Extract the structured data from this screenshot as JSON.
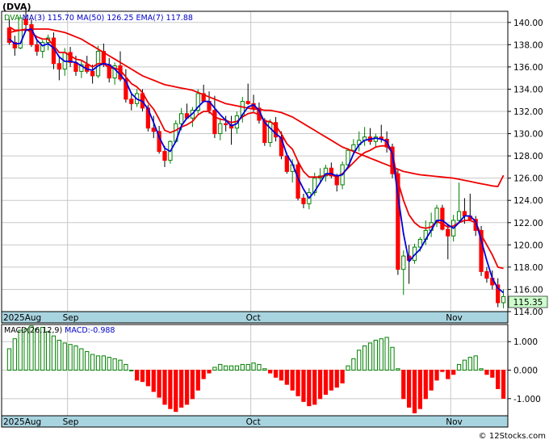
{
  "ticker_label": "(DVA)",
  "price_legend": [
    {
      "text": "DVA",
      "color": "#008000"
    },
    {
      "text": "MA(3)",
      "color": "#0000cc"
    },
    {
      "text": "115.70",
      "color": "#0000cc"
    },
    {
      "text": "MA(50)",
      "color": "#0000cc"
    },
    {
      "text": "126.25",
      "color": "#0000cc"
    },
    {
      "text": "EMA(7)",
      "color": "#0000cc"
    },
    {
      "text": "117.88",
      "color": "#0000cc"
    }
  ],
  "macd_legend": [
    {
      "text": "MACD(26,12,9)",
      "color": "#000000"
    },
    {
      "text": "MACD:-0.988",
      "color": "#0000cc"
    }
  ],
  "last_price_label": "115.35",
  "month_labels": [
    "2025Aug",
    "Sep",
    "Oct",
    "Nov"
  ],
  "copyright": "© 12Stocks.com",
  "colors": {
    "up_candle": "#008000",
    "down_candle": "#ff0000",
    "ma3": "#0000dd",
    "ema7": "#ee0000",
    "ma50": "#ee0000",
    "macd_bar_pos": "#008000",
    "macd_bar_neg": "#ff0000",
    "month_band": "#a8d4e0",
    "price_box": "#ccffcc",
    "grid": "#c8c8c8"
  },
  "chart_data": [
    {
      "type": "candlestick",
      "title": "(DVA)",
      "ylim": [
        114,
        141
      ],
      "y_ticks": [
        "114.00",
        "116.00",
        "118.00",
        "120.00",
        "122.00",
        "124.00",
        "126.00",
        "128.00",
        "130.00",
        "132.00",
        "134.00",
        "136.00",
        "138.00",
        "140.00"
      ],
      "y_tick_values": [
        114,
        116,
        118,
        120,
        122,
        124,
        126,
        128,
        130,
        132,
        134,
        136,
        138,
        140
      ],
      "x_month_labels": [
        {
          "label": "2025Aug",
          "index": 0
        },
        {
          "label": "Sep",
          "index": 11
        },
        {
          "label": "Oct",
          "index": 44
        },
        {
          "label": "Nov",
          "index": 80
        }
      ],
      "last_price": 115.35,
      "candles": [
        [
          139.5,
          140.3,
          138.0,
          138.2
        ],
        [
          138.2,
          138.8,
          137.0,
          137.7
        ],
        [
          137.7,
          140.7,
          137.6,
          140.4
        ],
        [
          140.3,
          141.3,
          139.3,
          139.8
        ],
        [
          139.8,
          140.3,
          137.8,
          138.0
        ],
        [
          138.0,
          138.4,
          137.0,
          137.4
        ],
        [
          137.4,
          138.4,
          136.8,
          138.2
        ],
        [
          138.2,
          138.9,
          137.5,
          138.6
        ],
        [
          138.6,
          139.1,
          135.8,
          136.3
        ],
        [
          136.3,
          137.0,
          134.8,
          135.8
        ],
        [
          135.8,
          137.7,
          135.2,
          137.3
        ],
        [
          137.3,
          137.8,
          136.0,
          136.4
        ],
        [
          136.4,
          137.0,
          135.2,
          135.6
        ],
        [
          135.6,
          136.6,
          135.0,
          136.2
        ],
        [
          136.2,
          137.0,
          135.4,
          135.6
        ],
        [
          135.6,
          136.2,
          134.5,
          135.2
        ],
        [
          135.2,
          137.9,
          135.0,
          137.4
        ],
        [
          137.4,
          138.1,
          136.0,
          136.2
        ],
        [
          136.2,
          136.8,
          134.6,
          135.0
        ],
        [
          135.0,
          136.4,
          134.4,
          136.1
        ],
        [
          136.1,
          137.4,
          134.7,
          134.9
        ],
        [
          134.9,
          135.8,
          132.8,
          133.1
        ],
        [
          133.1,
          133.6,
          132.1,
          132.7
        ],
        [
          132.7,
          134.0,
          132.4,
          133.6
        ],
        [
          133.6,
          134.0,
          132.0,
          132.3
        ],
        [
          132.3,
          132.6,
          130.2,
          130.5
        ],
        [
          130.5,
          131.6,
          129.6,
          130.2
        ],
        [
          130.2,
          130.7,
          128.2,
          128.4
        ],
        [
          128.4,
          128.9,
          127.0,
          127.6
        ],
        [
          127.6,
          129.4,
          127.3,
          129.3
        ],
        [
          129.3,
          131.2,
          129.2,
          130.9
        ],
        [
          130.9,
          132.3,
          130.3,
          131.8
        ],
        [
          131.8,
          132.7,
          131.3,
          131.4
        ],
        [
          131.4,
          132.4,
          130.6,
          132.1
        ],
        [
          132.1,
          134.0,
          131.8,
          133.6
        ],
        [
          133.6,
          134.4,
          132.8,
          132.9
        ],
        [
          132.9,
          133.8,
          131.8,
          132.1
        ],
        [
          132.1,
          133.4,
          129.6,
          130.0
        ],
        [
          130.0,
          131.4,
          129.4,
          130.9
        ],
        [
          130.9,
          131.6,
          130.2,
          130.8
        ],
        [
          130.8,
          131.6,
          129.0,
          130.5
        ],
        [
          130.5,
          132.0,
          130.0,
          131.6
        ],
        [
          131.6,
          133.3,
          131.0,
          132.9
        ],
        [
          132.9,
          134.5,
          132.6,
          132.7
        ],
        [
          132.7,
          133.5,
          132.0,
          132.3
        ],
        [
          132.3,
          132.8,
          130.9,
          131.2
        ],
        [
          131.2,
          131.4,
          128.9,
          129.2
        ],
        [
          129.2,
          131.3,
          128.8,
          131.0
        ],
        [
          131.0,
          131.5,
          129.3,
          129.7
        ],
        [
          129.7,
          130.2,
          127.7,
          128.0
        ],
        [
          128.0,
          128.3,
          126.4,
          126.6
        ],
        [
          126.6,
          127.7,
          125.6,
          127.2
        ],
        [
          127.2,
          127.5,
          124.0,
          124.2
        ],
        [
          124.2,
          124.6,
          123.3,
          123.7
        ],
        [
          123.7,
          125.1,
          123.2,
          124.7
        ],
        [
          124.7,
          126.5,
          124.4,
          126.0
        ],
        [
          126.0,
          126.9,
          125.5,
          126.2
        ],
        [
          126.2,
          127.2,
          125.7,
          126.9
        ],
        [
          126.9,
          127.4,
          126.0,
          126.2
        ],
        [
          126.2,
          126.4,
          124.8,
          125.4
        ],
        [
          125.4,
          127.5,
          125.0,
          127.2
        ],
        [
          127.2,
          128.7,
          127.0,
          128.5
        ],
        [
          128.5,
          129.5,
          128.1,
          129.0
        ],
        [
          129.0,
          130.2,
          128.4,
          129.4
        ],
        [
          129.4,
          130.6,
          128.9,
          129.7
        ],
        [
          129.7,
          130.5,
          129.0,
          129.3
        ],
        [
          129.3,
          130.0,
          128.8,
          129.7
        ],
        [
          129.7,
          130.8,
          129.2,
          129.5
        ],
        [
          129.5,
          130.2,
          128.3,
          128.8
        ],
        [
          128.8,
          129.1,
          126.0,
          126.4
        ],
        [
          126.4,
          126.8,
          117.3,
          117.8
        ],
        [
          117.8,
          119.5,
          115.5,
          119.0
        ],
        [
          119.0,
          120.0,
          116.5,
          118.6
        ],
        [
          118.6,
          120.1,
          118.3,
          119.8
        ],
        [
          119.8,
          120.7,
          119.4,
          120.5
        ],
        [
          120.5,
          122.2,
          120.0,
          121.3
        ],
        [
          121.3,
          122.9,
          120.7,
          122.0
        ],
        [
          122.0,
          123.6,
          121.6,
          123.3
        ],
        [
          123.3,
          123.6,
          121.3,
          121.4
        ],
        [
          121.4,
          121.9,
          118.7,
          120.8
        ],
        [
          120.8,
          122.7,
          120.3,
          122.2
        ],
        [
          122.2,
          125.6,
          121.9,
          123.0
        ],
        [
          123.0,
          124.2,
          121.9,
          122.6
        ],
        [
          122.6,
          124.6,
          122.2,
          122.3
        ],
        [
          122.3,
          122.6,
          120.8,
          121.3
        ],
        [
          121.3,
          121.7,
          117.2,
          117.6
        ],
        [
          117.6,
          118.0,
          116.6,
          117.0
        ],
        [
          117.0,
          117.7,
          116.0,
          116.4
        ],
        [
          116.4,
          117.0,
          114.4,
          114.8
        ],
        [
          114.8,
          116.0,
          114.3,
          115.35
        ]
      ],
      "ma3": [
        138.5,
        138.1,
        138.1,
        139.3,
        139.4,
        138.4,
        137.9,
        138.1,
        137.7,
        136.9,
        136.5,
        136.5,
        136.4,
        136.1,
        135.8,
        135.7,
        136.1,
        136.3,
        136.2,
        135.8,
        135.3,
        134.7,
        133.6,
        133.1,
        132.9,
        132.2,
        131.0,
        129.7,
        128.7,
        128.4,
        129.3,
        130.7,
        131.4,
        131.8,
        132.4,
        132.9,
        132.9,
        132.3,
        131.7,
        131.2,
        130.7,
        130.9,
        131.7,
        132.4,
        132.6,
        132.1,
        131.0,
        130.5,
        130.0,
        129.6,
        128.1,
        127.3,
        126.0,
        125.0,
        124.2,
        124.8,
        125.6,
        126.4,
        126.4,
        126.2,
        126.3,
        127.0,
        128.2,
        129.0,
        129.4,
        129.5,
        129.6,
        129.5,
        129.3,
        128.2,
        124.4,
        121.0,
        118.5,
        119.1,
        119.6,
        120.5,
        121.3,
        122.2,
        122.2,
        121.8,
        121.5,
        122.0,
        122.6,
        122.6,
        122.1,
        120.4,
        118.6,
        117.0,
        116.1,
        115.7
      ],
      "ema7": [
        139.6,
        139.3,
        139.3,
        139.4,
        139.1,
        138.7,
        138.5,
        138.5,
        137.9,
        137.3,
        137.3,
        137.0,
        136.7,
        136.6,
        136.3,
        136.0,
        136.3,
        136.3,
        135.9,
        135.9,
        135.7,
        135.1,
        134.5,
        134.2,
        133.7,
        132.8,
        132.2,
        131.3,
        130.3,
        130.1,
        130.3,
        130.6,
        130.8,
        131.1,
        131.7,
        132.0,
        132.0,
        131.5,
        131.3,
        131.2,
        131.0,
        131.1,
        131.5,
        131.8,
        131.9,
        131.7,
        131.1,
        131.1,
        130.7,
        130.0,
        129.1,
        128.6,
        127.5,
        126.6,
        126.1,
        126.1,
        126.1,
        126.3,
        126.3,
        126.1,
        126.4,
        126.9,
        127.4,
        127.9,
        128.3,
        128.5,
        128.8,
        128.9,
        128.9,
        128.3,
        125.7,
        124.0,
        122.7,
        122.0,
        121.6,
        121.5,
        121.6,
        122.1,
        121.9,
        121.6,
        121.7,
        122.0,
        122.2,
        122.2,
        122.0,
        120.9,
        120.0,
        119.1,
        118.0,
        117.88
      ],
      "ma50": [
        139.1,
        139.2,
        139.3,
        139.3,
        139.4,
        139.4,
        139.4,
        139.4,
        139.3,
        139.2,
        139.1,
        138.9,
        138.7,
        138.5,
        138.2,
        137.9,
        137.6,
        137.3,
        137.0,
        136.7,
        136.4,
        136.1,
        135.8,
        135.5,
        135.2,
        135.0,
        134.8,
        134.6,
        134.4,
        134.3,
        134.2,
        134.1,
        134.0,
        133.9,
        133.7,
        133.5,
        133.3,
        133.1,
        132.9,
        132.7,
        132.6,
        132.5,
        132.4,
        132.3,
        132.2,
        132.2,
        132.1,
        132.1,
        132.0,
        131.9,
        131.7,
        131.5,
        131.2,
        130.9,
        130.6,
        130.3,
        130.0,
        129.7,
        129.4,
        129.1,
        128.8,
        128.6,
        128.4,
        128.2,
        128.0,
        127.8,
        127.6,
        127.4,
        127.2,
        127.0,
        126.8,
        126.6,
        126.5,
        126.4,
        126.3,
        126.25,
        126.2,
        126.15,
        126.1,
        126.05,
        126.0,
        125.9,
        125.8,
        125.7,
        125.6,
        125.5,
        125.4,
        125.3,
        125.25,
        126.25
      ]
    },
    {
      "type": "bar",
      "title": "MACD(26,12,9)",
      "ylim": [
        -1.6,
        1.6
      ],
      "y_ticks": [
        "1.000",
        "0.000",
        "-1.000"
      ],
      "y_tick_values": [
        1,
        0,
        -1
      ],
      "macd_value": -0.988,
      "values": [
        0.75,
        1.1,
        1.4,
        1.45,
        1.55,
        1.45,
        1.5,
        1.35,
        1.2,
        1.05,
        0.95,
        0.9,
        0.85,
        0.75,
        0.65,
        0.55,
        0.5,
        0.5,
        0.45,
        0.4,
        0.35,
        0.2,
        0.0,
        -0.35,
        -0.4,
        -0.55,
        -0.75,
        -0.95,
        -1.2,
        -1.35,
        -1.45,
        -1.3,
        -1.2,
        -1.0,
        -0.7,
        -0.3,
        -0.1,
        0.1,
        0.2,
        0.15,
        0.15,
        0.15,
        0.2,
        0.2,
        0.25,
        0.2,
        0.05,
        -0.1,
        -0.25,
        -0.35,
        -0.5,
        -0.7,
        -0.9,
        -1.1,
        -1.25,
        -1.2,
        -1.0,
        -0.85,
        -0.7,
        -0.6,
        -0.45,
        0.15,
        0.4,
        0.7,
        0.85,
        0.95,
        1.05,
        1.1,
        1.15,
        0.8,
        0.05,
        -1.0,
        -1.3,
        -1.5,
        -1.35,
        -1.0,
        -0.7,
        -0.35,
        -0.05,
        -0.3,
        -0.15,
        0.2,
        0.35,
        0.45,
        0.5,
        0.05,
        -0.15,
        -0.25,
        -0.65,
        -0.988
      ]
    }
  ]
}
